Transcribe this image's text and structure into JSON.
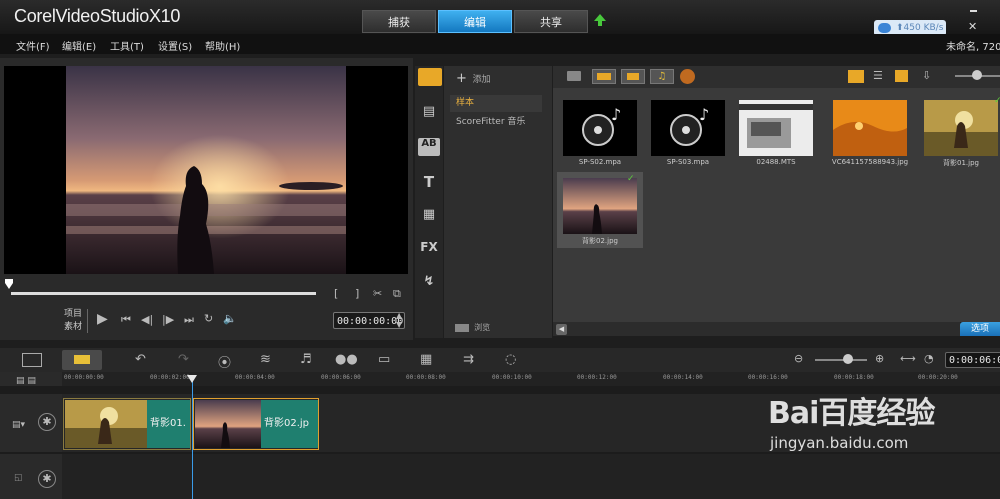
{
  "app": {
    "title_prefix": "Corel",
    "title_main": "VideoStudio",
    "title_version": "X10"
  },
  "mode_tabs": [
    {
      "label": "捕获"
    },
    {
      "label": "编辑"
    },
    {
      "label": "共享"
    }
  ],
  "speed_badge": "⬆450 KB/s",
  "menu": [
    "文件(F)",
    "编辑(E)",
    "工具(T)",
    "设置(S)",
    "帮助(H)"
  ],
  "project_name": "未命名, 720*",
  "preview": {
    "mode_project": "项目",
    "mode_clip": "素材",
    "timecode": "00:00:00:00"
  },
  "library": {
    "add_label": "添加",
    "folders": [
      "样本",
      "ScoreFitter 音乐"
    ],
    "browse_label": "浏览",
    "options_label": "选项",
    "items": [
      {
        "label": "SP-S02.mpa",
        "kind": "audio"
      },
      {
        "label": "SP-S03.mpa",
        "kind": "audio"
      },
      {
        "label": "02488.MTS",
        "kind": "video"
      },
      {
        "label": "VC641157588943.jpg",
        "kind": "image"
      },
      {
        "label": "背影01.jpg",
        "kind": "image"
      },
      {
        "label": "背影02.jpg",
        "kind": "image"
      }
    ]
  },
  "timeline": {
    "timecode": "0:00:06:00",
    "ruler": [
      "00:00:00:00",
      "00:00:02:00",
      "00:00:04:00",
      "00:00:06:00",
      "00:00:08:00",
      "00:00:10:00",
      "00:00:12:00",
      "00:00:14:00",
      "00:00:16:00",
      "00:00:18:00",
      "00:00:20:00"
    ],
    "clips": [
      {
        "label": "背影01."
      },
      {
        "label": "背影02.jp"
      }
    ]
  },
  "watermark": {
    "brand": "Bai百度经验",
    "url": "jingyan.baidu.com"
  },
  "colors": {
    "accent": "#1e8fd8",
    "clip_teal": "#1f7f6f",
    "folder_active": "#e8b040"
  }
}
